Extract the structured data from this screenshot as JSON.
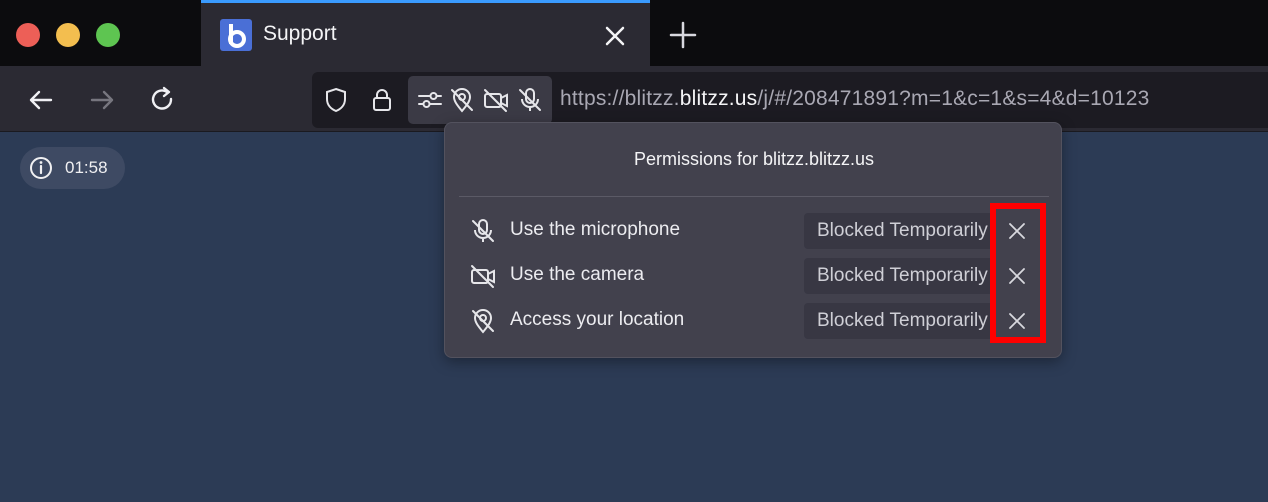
{
  "tab": {
    "title": "Support"
  },
  "url": {
    "prefix": "https://blitzz.",
    "host": "blitzz.us",
    "path": "/j/#/208471891?m=1&c=1&s=4&d=10123"
  },
  "timer": {
    "time": "01:58"
  },
  "popup": {
    "title": "Permissions for blitzz.blitzz.us",
    "permissions": [
      {
        "label": "Use the microphone",
        "status": "Blocked Temporarily",
        "icon": "microphone-blocked-icon"
      },
      {
        "label": "Use the camera",
        "status": "Blocked Temporarily",
        "icon": "camera-blocked-icon"
      },
      {
        "label": "Access your location",
        "status": "Blocked Temporarily",
        "icon": "location-blocked-icon"
      }
    ]
  },
  "colors": {
    "background": "#2c3b55",
    "highlight": "#ff0000",
    "tab_accent": "#3a9bff"
  }
}
